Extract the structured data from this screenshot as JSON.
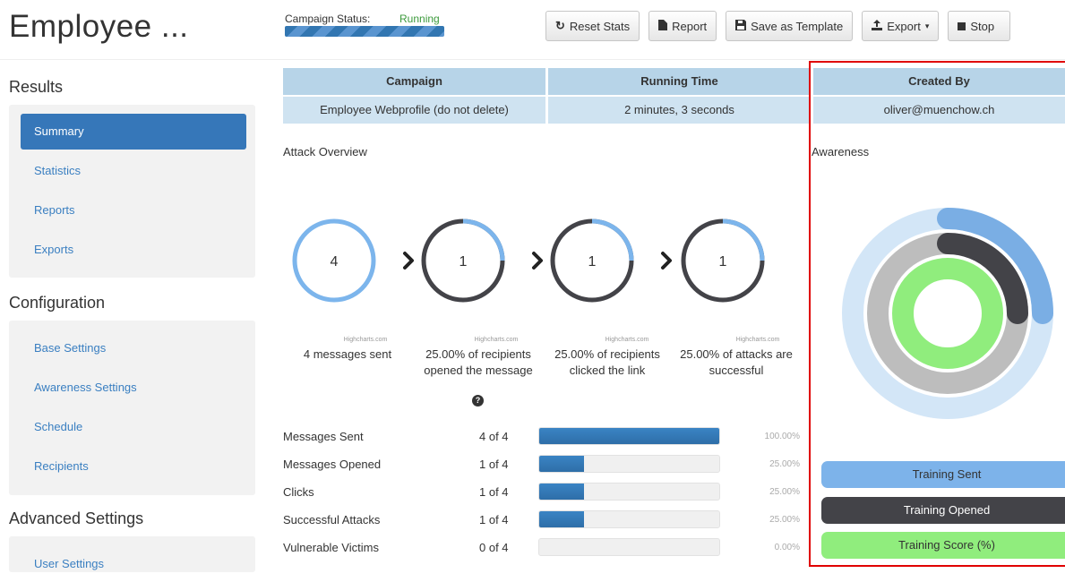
{
  "header": {
    "title": "Employee ...",
    "status_label": "Campaign Status:",
    "status_value": "Running",
    "buttons": {
      "reset": "Reset Stats",
      "report": "Report",
      "save_template": "Save as Template",
      "export": "Export",
      "stop": "Stop"
    }
  },
  "sidebar": {
    "results_title": "Results",
    "results_items": [
      "Summary",
      "Statistics",
      "Reports",
      "Exports"
    ],
    "config_title": "Configuration",
    "config_items": [
      "Base Settings",
      "Awareness Settings",
      "Schedule",
      "Recipients"
    ],
    "advanced_title": "Advanced Settings",
    "advanced_items": [
      "User Settings"
    ]
  },
  "campaign_table": {
    "headers": [
      "Campaign",
      "Running Time",
      "Created By"
    ],
    "values": [
      "Employee Webprofile (do not delete)",
      "2 minutes, 3 seconds",
      "oliver@muenchow.ch"
    ]
  },
  "attack_overview": {
    "title": "Attack Overview",
    "credit": "Highcharts.com",
    "gauges": [
      {
        "value": "4",
        "fraction": 1.0,
        "caption": "4 messages sent"
      },
      {
        "value": "1",
        "fraction": 0.25,
        "caption": "25.00% of recipients opened the message"
      },
      {
        "value": "1",
        "fraction": 0.25,
        "caption": "25.00% of recipients clicked the link"
      },
      {
        "value": "1",
        "fraction": 0.25,
        "caption": "25.00% of attacks are successful"
      }
    ]
  },
  "stats": {
    "rows": [
      {
        "label": "Messages Sent",
        "count": "4 of 4",
        "percent": "100.00%",
        "fraction": 1.0
      },
      {
        "label": "Messages Opened",
        "count": "1 of 4",
        "percent": "25.00%",
        "fraction": 0.25
      },
      {
        "label": "Clicks",
        "count": "1 of 4",
        "percent": "25.00%",
        "fraction": 0.25
      },
      {
        "label": "Successful Attacks",
        "count": "1 of 4",
        "percent": "25.00%",
        "fraction": 0.25
      },
      {
        "label": "Vulnerable Victims",
        "count": "0 of 4",
        "percent": "0.00%",
        "fraction": 0.0
      }
    ]
  },
  "awareness": {
    "title": "Awareness",
    "legend": [
      "Training Sent",
      "Training Opened",
      "Training Score (%)"
    ],
    "rings": [
      {
        "name": "Training Sent",
        "fraction": 0.25,
        "color": "#7aaee4",
        "track": "#d3e6f7"
      },
      {
        "name": "Training Opened",
        "fraction": 0.25,
        "color": "#434348",
        "track": "#bdbdbd"
      },
      {
        "name": "Training Score (%)",
        "fraction": 0.0,
        "color": "#90ed7d",
        "track": "#90ed7d"
      }
    ]
  },
  "colors": {
    "accent": "#3677b9",
    "running": "#3c9a3c",
    "gauge_blue": "#7cb5ec",
    "gauge_dark": "#434348",
    "highlight": "#e00000"
  }
}
